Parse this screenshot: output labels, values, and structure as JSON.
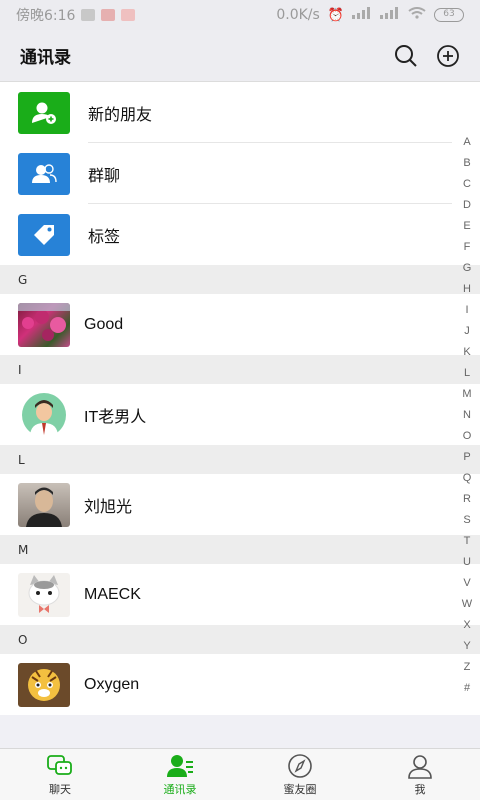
{
  "status_bar": {
    "time": "傍晚6:16",
    "network_speed": "0.0K/s",
    "battery": "63"
  },
  "header": {
    "title": "通讯录"
  },
  "functions": [
    {
      "label": "新的朋友",
      "icon": "add-friend-icon",
      "color": "#1aad19"
    },
    {
      "label": "群聊",
      "icon": "group-chat-icon",
      "color": "#2782d7"
    },
    {
      "label": "标签",
      "icon": "tag-icon",
      "color": "#2782d7"
    }
  ],
  "sections": [
    {
      "letter": "G",
      "contacts": [
        {
          "name": "Good",
          "avatar": "flowers-avatar"
        }
      ]
    },
    {
      "letter": "I",
      "contacts": [
        {
          "name": "IT老男人",
          "avatar": "cartoon-man-avatar"
        }
      ]
    },
    {
      "letter": "L",
      "contacts": [
        {
          "name": "刘旭光",
          "avatar": "photo-man-avatar"
        }
      ]
    },
    {
      "letter": "M",
      "contacts": [
        {
          "name": "MAECK",
          "avatar": "cat-avatar"
        }
      ]
    },
    {
      "letter": "O",
      "contacts": [
        {
          "name": "Oxygen",
          "avatar": "tiger-avatar"
        }
      ]
    }
  ],
  "index_letters": [
    "A",
    "B",
    "C",
    "D",
    "E",
    "F",
    "G",
    "H",
    "I",
    "J",
    "K",
    "L",
    "M",
    "N",
    "O",
    "P",
    "Q",
    "R",
    "S",
    "T",
    "U",
    "V",
    "W",
    "X",
    "Y",
    "Z",
    "#"
  ],
  "tabs": [
    {
      "label": "聊天",
      "icon": "chat-icon",
      "active": false
    },
    {
      "label": "通讯录",
      "icon": "contacts-icon",
      "active": true
    },
    {
      "label": "蜜友圈",
      "icon": "compass-icon",
      "active": false
    },
    {
      "label": "我",
      "icon": "profile-icon",
      "active": false
    }
  ],
  "colors": {
    "accent": "#1aad19",
    "blue": "#2782d7"
  }
}
